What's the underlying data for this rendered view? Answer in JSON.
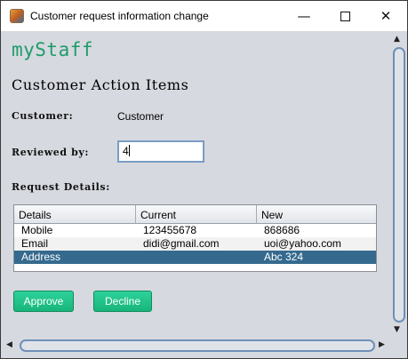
{
  "window": {
    "title": "Customer request information change",
    "minimize_glyph": "—",
    "close_glyph": "✕"
  },
  "brand": "myStaff",
  "section_title": "Customer Action Items",
  "customer": {
    "label": "Customer:",
    "value": "Customer"
  },
  "reviewer": {
    "label": "Reviewed by:",
    "value": "4"
  },
  "request_details_label": "Request Details:",
  "table": {
    "columns": [
      "Details",
      "Current",
      "New"
    ],
    "rows": [
      [
        "Mobile",
        "123455678",
        "868686"
      ],
      [
        "Email",
        "didi@gmail.com",
        "uoi@yahoo.com"
      ],
      [
        "Address",
        "",
        "Abc 324"
      ]
    ],
    "selected_row": 2
  },
  "buttons": {
    "approve": "Approve",
    "decline": "Decline"
  },
  "scroll": {
    "up": "▲",
    "down": "▼",
    "left": "◀",
    "right": "▶"
  },
  "colors": {
    "brand": "#1d9c6a",
    "button": "#17b57c",
    "selection": "#356a8e",
    "input_border": "#7a9cc4"
  }
}
